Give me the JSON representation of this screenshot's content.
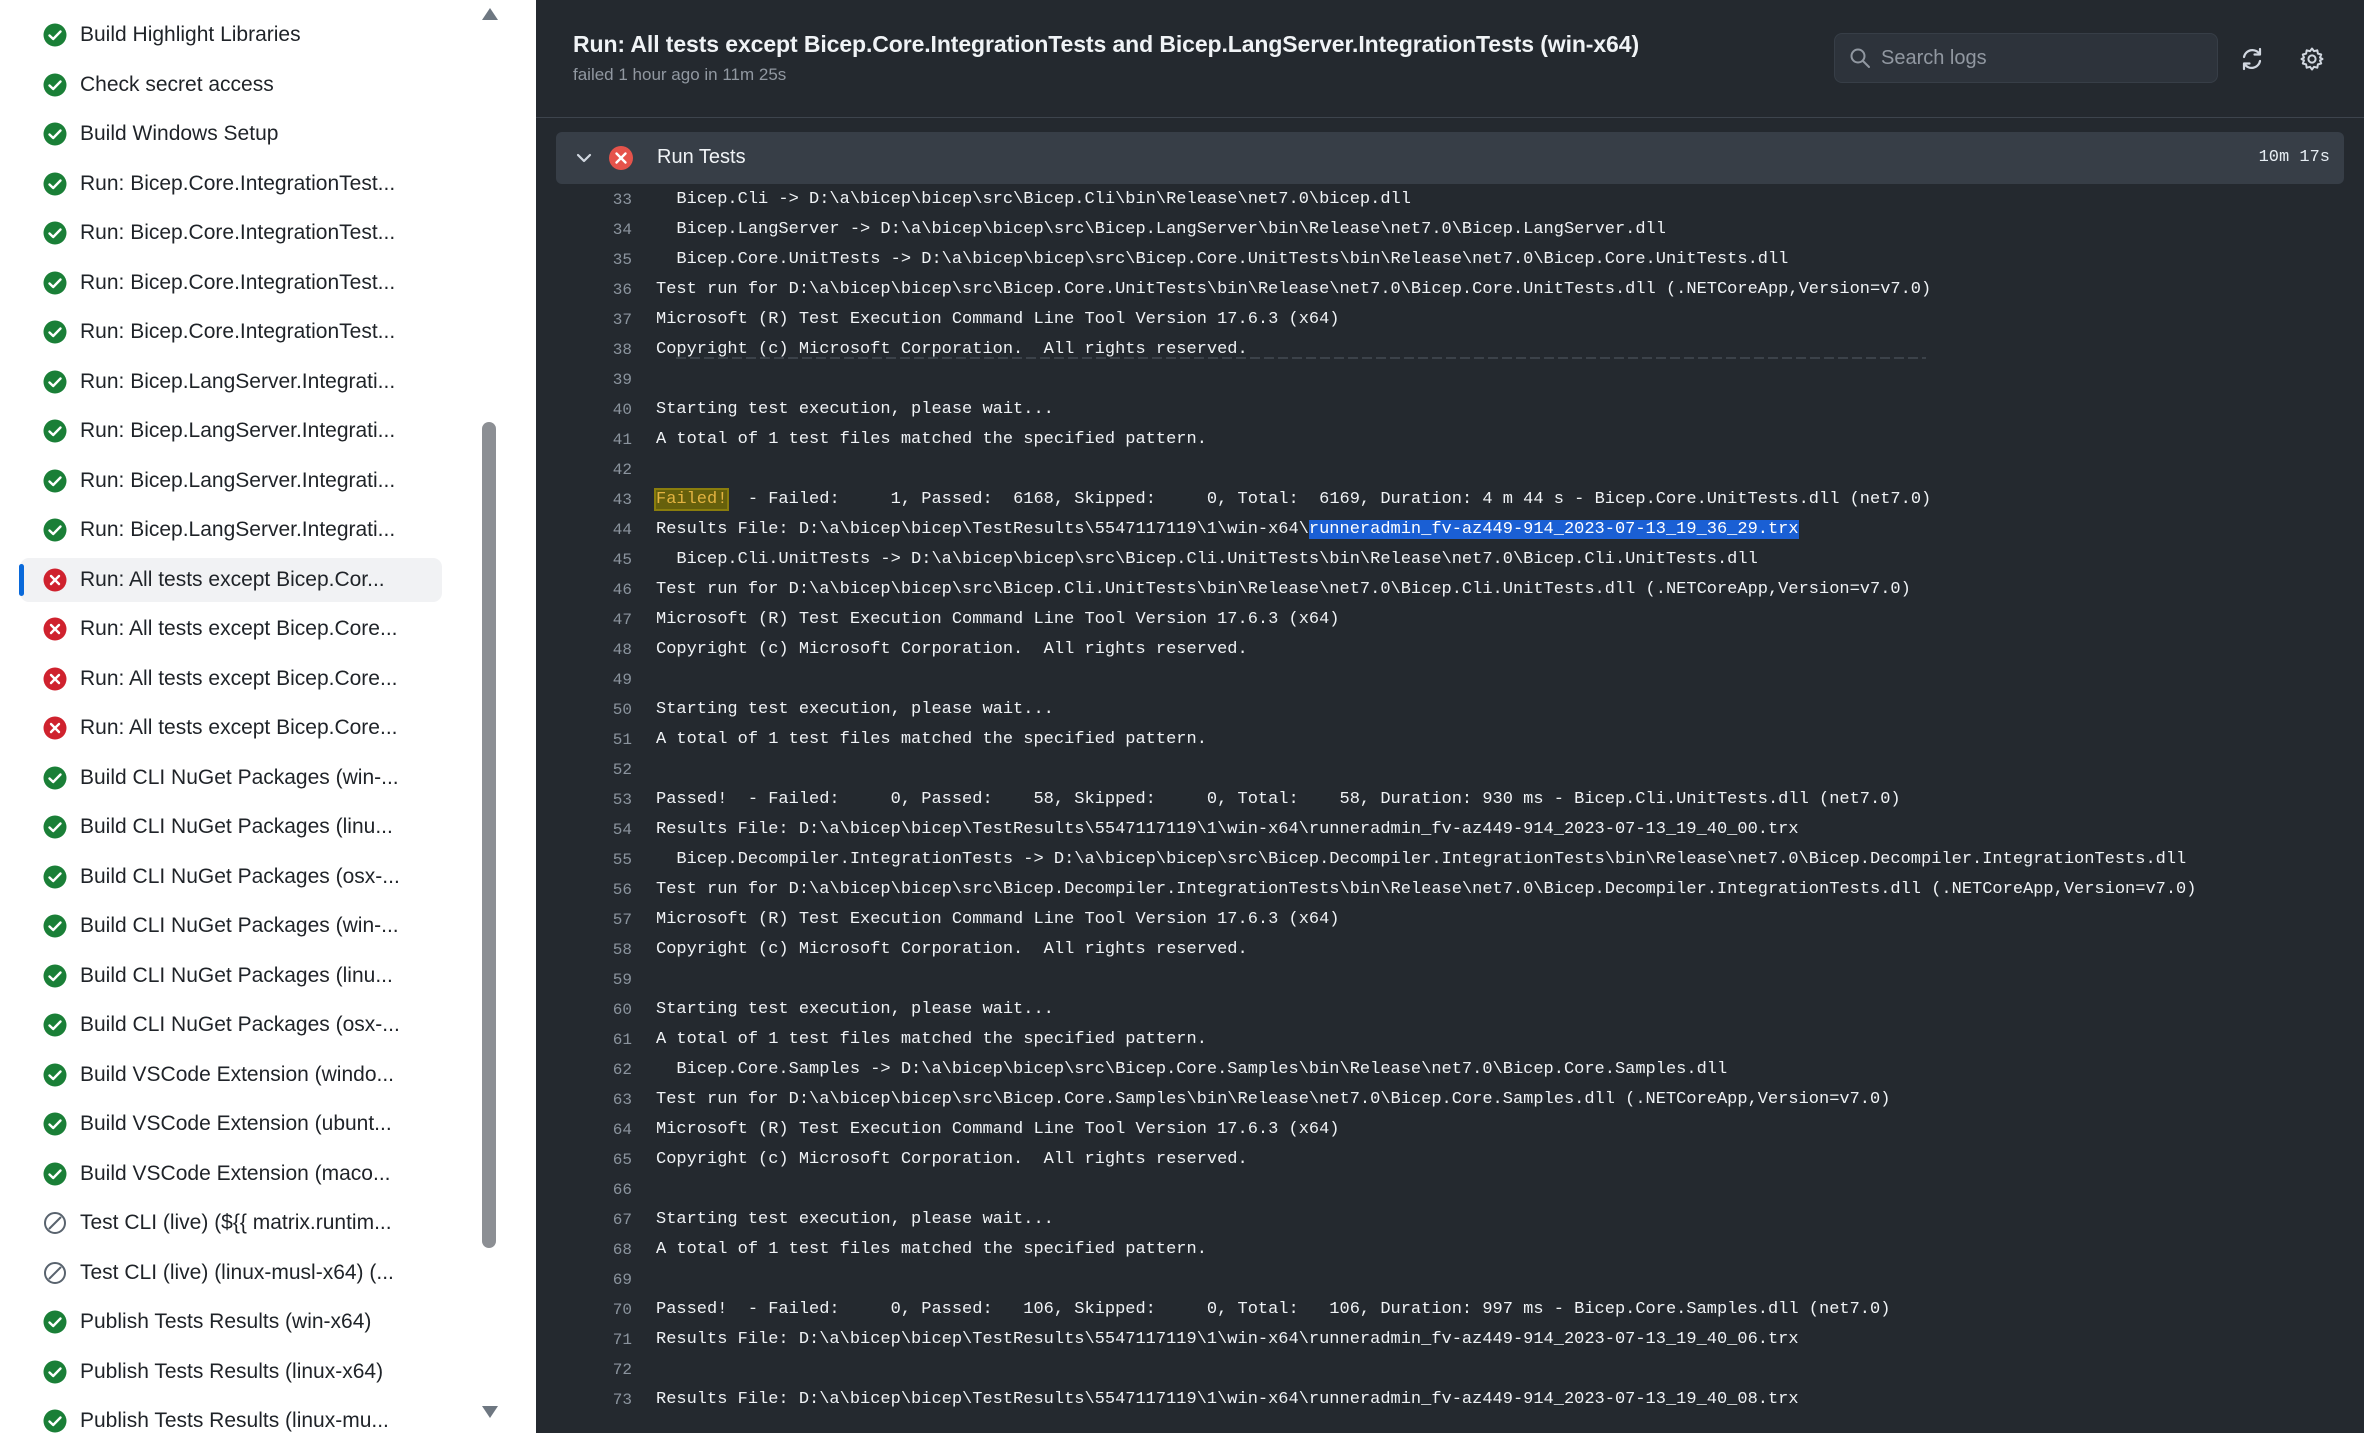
{
  "sidebar": {
    "jobs": [
      {
        "label": "Build Highlight Libraries",
        "status": "success"
      },
      {
        "label": "Check secret access",
        "status": "success"
      },
      {
        "label": "Build Windows Setup",
        "status": "success"
      },
      {
        "label": "Run: Bicep.Core.IntegrationTest...",
        "status": "success"
      },
      {
        "label": "Run: Bicep.Core.IntegrationTest...",
        "status": "success"
      },
      {
        "label": "Run: Bicep.Core.IntegrationTest...",
        "status": "success"
      },
      {
        "label": "Run: Bicep.Core.IntegrationTest...",
        "status": "success"
      },
      {
        "label": "Run: Bicep.LangServer.Integrati...",
        "status": "success"
      },
      {
        "label": "Run: Bicep.LangServer.Integrati...",
        "status": "success"
      },
      {
        "label": "Run: Bicep.LangServer.Integrati...",
        "status": "success"
      },
      {
        "label": "Run: Bicep.LangServer.Integrati...",
        "status": "success"
      },
      {
        "label": "Run: All tests except Bicep.Cor...",
        "status": "failure",
        "selected": true
      },
      {
        "label": "Run: All tests except Bicep.Core...",
        "status": "failure"
      },
      {
        "label": "Run: All tests except Bicep.Core...",
        "status": "failure"
      },
      {
        "label": "Run: All tests except Bicep.Core...",
        "status": "failure"
      },
      {
        "label": "Build CLI NuGet Packages (win-...",
        "status": "success"
      },
      {
        "label": "Build CLI NuGet Packages (linu...",
        "status": "success"
      },
      {
        "label": "Build CLI NuGet Packages (osx-...",
        "status": "success"
      },
      {
        "label": "Build CLI NuGet Packages (win-...",
        "status": "success"
      },
      {
        "label": "Build CLI NuGet Packages (linu...",
        "status": "success"
      },
      {
        "label": "Build CLI NuGet Packages (osx-...",
        "status": "success"
      },
      {
        "label": "Build VSCode Extension (windo...",
        "status": "success"
      },
      {
        "label": "Build VSCode Extension (ubunt...",
        "status": "success"
      },
      {
        "label": "Build VSCode Extension (maco...",
        "status": "success"
      },
      {
        "label": "Test CLI (live) (${{ matrix.runtim...",
        "status": "skipped"
      },
      {
        "label": "Test CLI (live) (linux-musl-x64) (...",
        "status": "skipped"
      },
      {
        "label": "Publish Tests Results (win-x64)",
        "status": "success"
      },
      {
        "label": "Publish Tests Results (linux-x64)",
        "status": "success"
      },
      {
        "label": "Publish Tests Results (linux-mu...",
        "status": "success"
      }
    ]
  },
  "header": {
    "title": "Run: All tests except Bicep.Core.IntegrationTests and Bicep.LangServer.IntegrationTests (win-x64)",
    "meta": "failed 1 hour ago in 11m 25s",
    "search_placeholder": "Search logs"
  },
  "step": {
    "name": "Run Tests",
    "duration": "10m 17s",
    "status": "failure"
  },
  "log_lines": [
    {
      "num": "33",
      "text": "  Bicep.Cli -> D:\\a\\bicep\\bicep\\src\\Bicep.Cli\\bin\\Release\\net7.0\\bicep.dll"
    },
    {
      "num": "34",
      "text": "  Bicep.LangServer -> D:\\a\\bicep\\bicep\\src\\Bicep.LangServer\\bin\\Release\\net7.0\\Bicep.LangServer.dll"
    },
    {
      "num": "35",
      "text": "  Bicep.Core.UnitTests -> D:\\a\\bicep\\bicep\\src\\Bicep.Core.UnitTests\\bin\\Release\\net7.0\\Bicep.Core.UnitTests.dll"
    },
    {
      "num": "36",
      "text": "Test run for D:\\a\\bicep\\bicep\\src\\Bicep.Core.UnitTests\\bin\\Release\\net7.0\\Bicep.Core.UnitTests.dll (.NETCoreApp,Version=v7.0)"
    },
    {
      "num": "37",
      "text": "Microsoft (R) Test Execution Command Line Tool Version 17.6.3 (x64)"
    },
    {
      "num": "38",
      "text": "Copyright (c) Microsoft Corporation.  All rights reserved."
    },
    {
      "num": "39",
      "text": ""
    },
    {
      "num": "40",
      "text": "Starting test execution, please wait..."
    },
    {
      "num": "41",
      "text": "A total of 1 test files matched the specified pattern."
    },
    {
      "num": "42",
      "text": ""
    },
    {
      "num": "43",
      "text": "",
      "failed_prefix": "Failed!",
      "rest": "  - Failed:     1, Passed:  6168, Skipped:     0, Total:  6169, Duration: 4 m 44 s - Bicep.Core.UnitTests.dll (net7.0)"
    },
    {
      "num": "44",
      "text": "",
      "prefix": "Results File: D:\\a\\bicep\\bicep\\TestResults\\5547117119\\1\\win-x64\\",
      "selected": "runneradmin_fv-az449-914_2023-07-13_19_36_29.trx"
    },
    {
      "num": "45",
      "text": "  Bicep.Cli.UnitTests -> D:\\a\\bicep\\bicep\\src\\Bicep.Cli.UnitTests\\bin\\Release\\net7.0\\Bicep.Cli.UnitTests.dll"
    },
    {
      "num": "46",
      "text": "Test run for D:\\a\\bicep\\bicep\\src\\Bicep.Cli.UnitTests\\bin\\Release\\net7.0\\Bicep.Cli.UnitTests.dll (.NETCoreApp,Version=v7.0)"
    },
    {
      "num": "47",
      "text": "Microsoft (R) Test Execution Command Line Tool Version 17.6.3 (x64)"
    },
    {
      "num": "48",
      "text": "Copyright (c) Microsoft Corporation.  All rights reserved."
    },
    {
      "num": "49",
      "text": ""
    },
    {
      "num": "50",
      "text": "Starting test execution, please wait..."
    },
    {
      "num": "51",
      "text": "A total of 1 test files matched the specified pattern."
    },
    {
      "num": "52",
      "text": ""
    },
    {
      "num": "53",
      "text": "Passed!  - Failed:     0, Passed:    58, Skipped:     0, Total:    58, Duration: 930 ms - Bicep.Cli.UnitTests.dll (net7.0)"
    },
    {
      "num": "54",
      "text": "Results File: D:\\a\\bicep\\bicep\\TestResults\\5547117119\\1\\win-x64\\runneradmin_fv-az449-914_2023-07-13_19_40_00.trx"
    },
    {
      "num": "55",
      "text": "  Bicep.Decompiler.IntegrationTests -> D:\\a\\bicep\\bicep\\src\\Bicep.Decompiler.IntegrationTests\\bin\\Release\\net7.0\\Bicep.Decompiler.IntegrationTests.dll"
    },
    {
      "num": "56",
      "text": "Test run for D:\\a\\bicep\\bicep\\src\\Bicep.Decompiler.IntegrationTests\\bin\\Release\\net7.0\\Bicep.Decompiler.IntegrationTests.dll (.NETCoreApp,Version=v7.0)"
    },
    {
      "num": "57",
      "text": "Microsoft (R) Test Execution Command Line Tool Version 17.6.3 (x64)"
    },
    {
      "num": "58",
      "text": "Copyright (c) Microsoft Corporation.  All rights reserved."
    },
    {
      "num": "59",
      "text": ""
    },
    {
      "num": "60",
      "text": "Starting test execution, please wait..."
    },
    {
      "num": "61",
      "text": "A total of 1 test files matched the specified pattern."
    },
    {
      "num": "62",
      "text": "  Bicep.Core.Samples -> D:\\a\\bicep\\bicep\\src\\Bicep.Core.Samples\\bin\\Release\\net7.0\\Bicep.Core.Samples.dll"
    },
    {
      "num": "63",
      "text": "Test run for D:\\a\\bicep\\bicep\\src\\Bicep.Core.Samples\\bin\\Release\\net7.0\\Bicep.Core.Samples.dll (.NETCoreApp,Version=v7.0)"
    },
    {
      "num": "64",
      "text": "Microsoft (R) Test Execution Command Line Tool Version 17.6.3 (x64)"
    },
    {
      "num": "65",
      "text": "Copyright (c) Microsoft Corporation.  All rights reserved."
    },
    {
      "num": "66",
      "text": ""
    },
    {
      "num": "67",
      "text": "Starting test execution, please wait..."
    },
    {
      "num": "68",
      "text": "A total of 1 test files matched the specified pattern."
    },
    {
      "num": "69",
      "text": ""
    },
    {
      "num": "70",
      "text": "Passed!  - Failed:     0, Passed:   106, Skipped:     0, Total:   106, Duration: 997 ms - Bicep.Core.Samples.dll (net7.0)"
    },
    {
      "num": "71",
      "text": "Results File: D:\\a\\bicep\\bicep\\TestResults\\5547117119\\1\\win-x64\\runneradmin_fv-az449-914_2023-07-13_19_40_06.trx"
    },
    {
      "num": "72",
      "text": ""
    },
    {
      "num": "73",
      "text": "Results File: D:\\a\\bicep\\bicep\\TestResults\\5547117119\\1\\win-x64\\runneradmin_fv-az449-914_2023-07-13_19_40_08.trx"
    }
  ],
  "colors": {
    "success": "#1a7f37",
    "failure": "#cf222e",
    "skipped": "#59636e",
    "log_bg": "#24292f",
    "selection": "#1a5fd4"
  },
  "icons": {
    "success": "check-circle-icon",
    "failure": "x-circle-icon",
    "skipped": "skip-circle-icon"
  }
}
